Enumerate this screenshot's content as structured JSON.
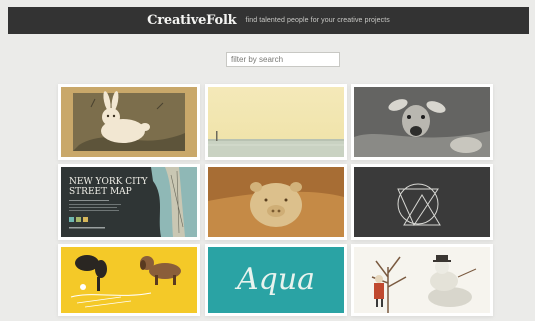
{
  "header": {
    "logo": "CreativeFolk",
    "tagline": "find talented people for your creative projects"
  },
  "search": {
    "placeholder": "filter by search"
  },
  "gallery": {
    "tiles": [
      {
        "icon": "rabbit-illustration"
      },
      {
        "icon": "lighthouse-seascape-photo"
      },
      {
        "icon": "deer-photo"
      },
      {
        "icon": "street-map-poster",
        "title_line1": "NEW YORK CITY",
        "title_line2": "STREET MAP"
      },
      {
        "icon": "pig-figurine-photo"
      },
      {
        "icon": "geometric-logo"
      },
      {
        "icon": "dog-illustration"
      },
      {
        "icon": "aqua-typography",
        "word": "Aqua"
      },
      {
        "icon": "snowman-illustration"
      }
    ]
  },
  "colors": {
    "header_bg": "#333333",
    "page_bg": "#ebebe9",
    "aqua_teal": "#2aa3a4",
    "yellow": "#f4c928"
  }
}
